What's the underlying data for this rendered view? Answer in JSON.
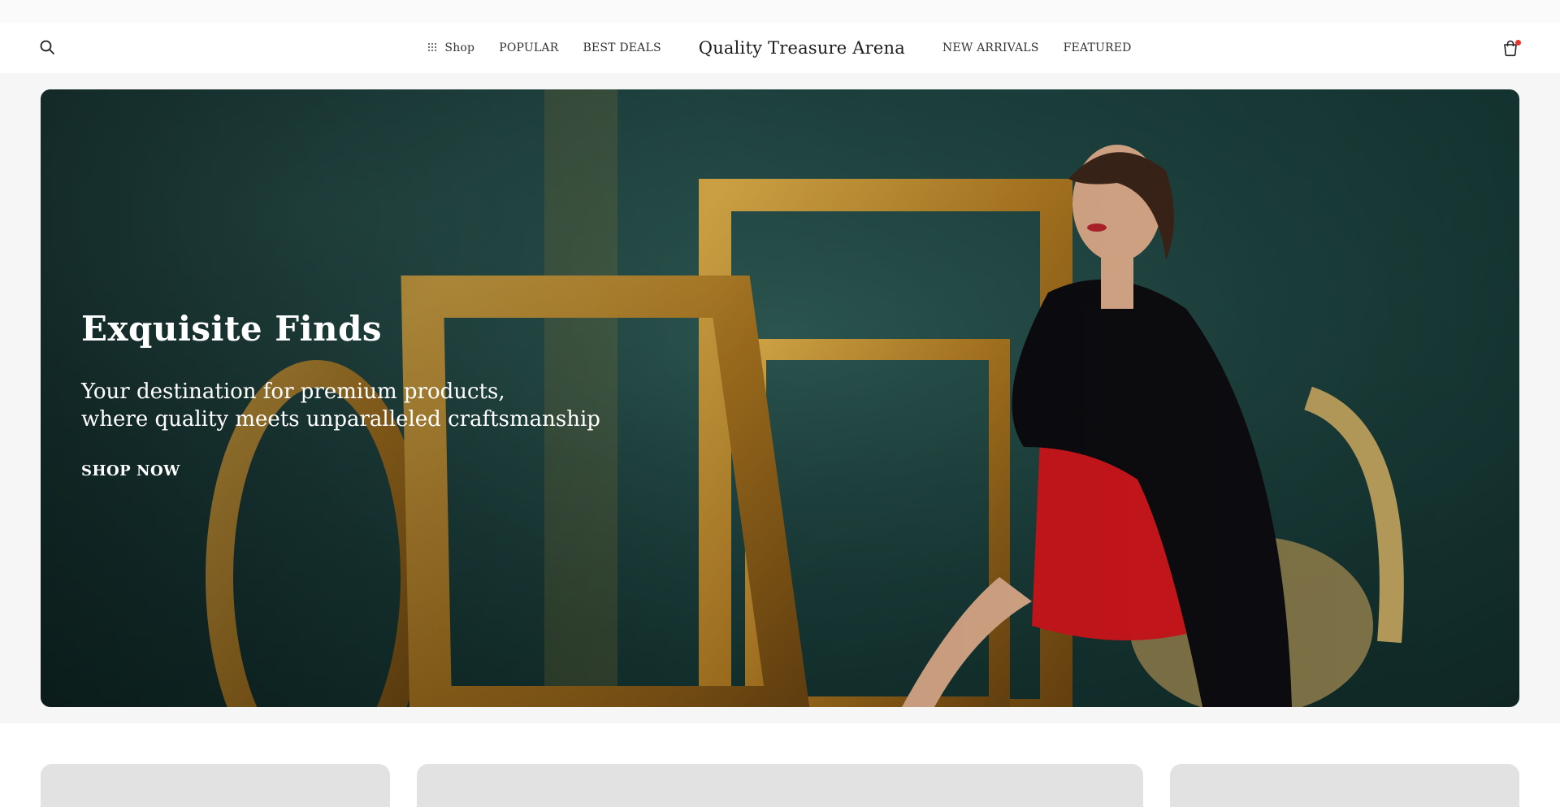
{
  "header": {
    "search_icon": "search-icon",
    "nav_left": [
      {
        "label": "Shop",
        "icon": "grid-icon"
      },
      {
        "label": "POPULAR"
      },
      {
        "label": "BEST DEALS"
      }
    ],
    "brand": "Quality Treasure Arena",
    "nav_right": [
      {
        "label": "NEW ARRIVALS"
      },
      {
        "label": "FEATURED"
      }
    ],
    "cart_icon": "shopping-bag-icon",
    "cart_badge_color": "#e8322b"
  },
  "hero": {
    "title": "Exquisite Finds",
    "subtitle_line1": "Your destination for premium products,",
    "subtitle_line2": "where quality meets unparalleled craftsmanship",
    "cta_label": "SHOP NOW"
  },
  "colors": {
    "page_bg": "#ffffff",
    "hero_band_bg": "#f6f6f7",
    "hero_bg": "#1e4543",
    "frame_gold": "#b8862b",
    "dress_red": "#c9161b",
    "card_placeholder": "#e2e2e2"
  }
}
